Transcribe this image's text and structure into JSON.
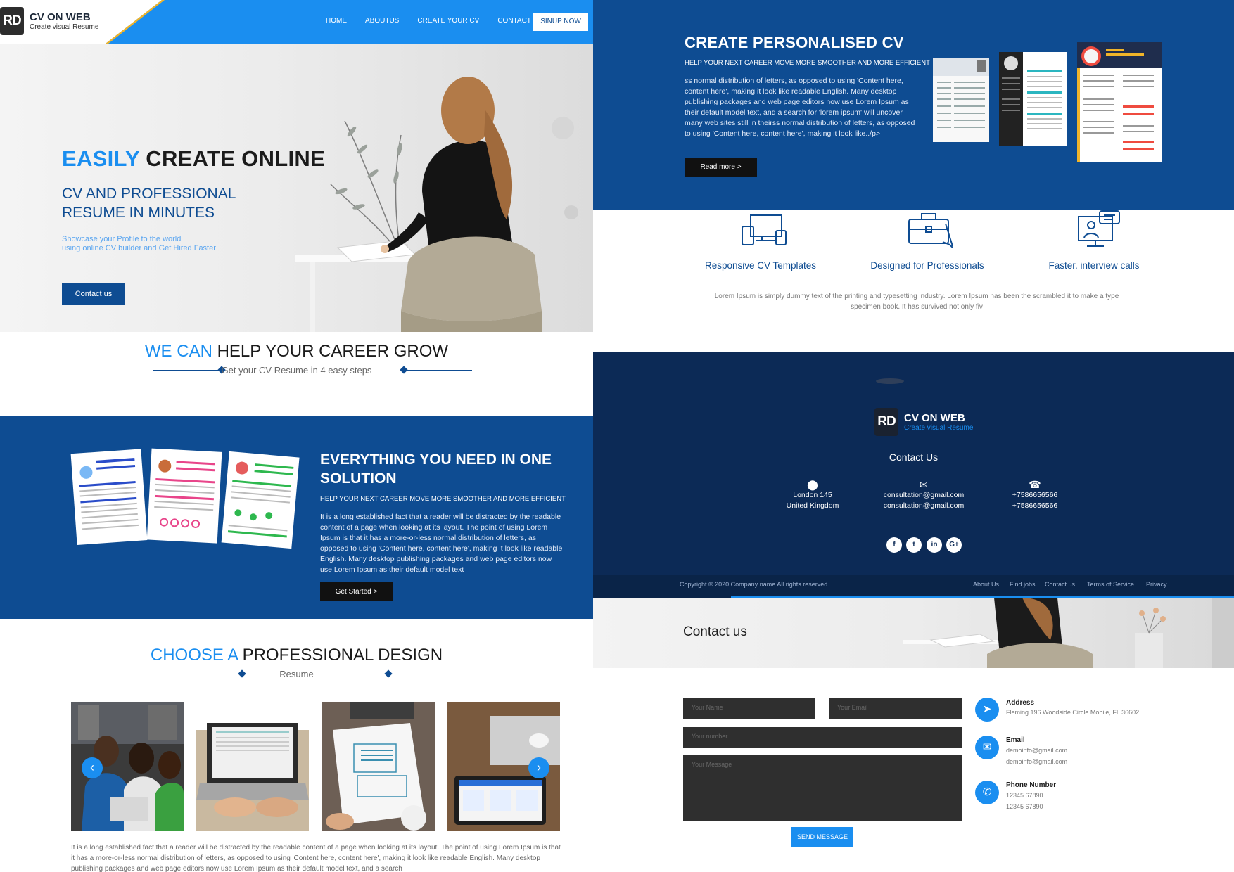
{
  "brand": {
    "mark": "RD",
    "name": "CV ON WEB",
    "tagline": "Create visual Resume"
  },
  "nav": {
    "items": [
      "HOME",
      "ABOUTUS",
      "CREATE YOUR CV",
      "CONTACT US"
    ],
    "cta": "SINUP NOW"
  },
  "hero": {
    "title_accent": "EASILY",
    "title_rest": " CREATE ONLINE",
    "subtitle": "CV AND PROFESSIONAL RESUME IN MINUTES",
    "tagline_1": "Showcase your Profile to the world",
    "tagline_2": "using online CV builder and Get Hired Faster",
    "button": "Contact us"
  },
  "wecan": {
    "title_accent": "WE CAN",
    "title_rest": " HELP YOUR CAREER GROW",
    "subtitle": "Get your CV Resume in 4 easy steps"
  },
  "everything": {
    "title": "EVERYTHING YOU NEED IN ONE SOLUTION",
    "kicker": "HELP YOUR NEXT CAREER MOVE MORE SMOOTHER AND MORE EFFICIENT",
    "body": "It is a long established fact that a reader will be distracted by the readable content of a page when looking at its layout. The point of using Lorem Ipsum is that it has a more-or-less normal distribution of letters, as opposed to using 'Content here, content here', making it look like readable English. Many desktop publishing packages and web page editors now use Lorem Ipsum as their default model text",
    "button": "Get Started >"
  },
  "choose": {
    "title_accent": "CHOOSE A",
    "title_rest": " PROFESSIONAL DESIGN",
    "subtitle": "Resume",
    "body": "It is a long established fact that a reader will be distracted by the readable content of a page when looking at its layout. The point of using Lorem Ipsum is that it has a more-or-less normal distribution of letters, as opposed to using 'Content here, content here', making it look like readable English. Many desktop publishing packages and web page editors now use Lorem Ipsum as their default model text, and a search",
    "prev": "‹",
    "next": "›"
  },
  "create": {
    "title": "CREATE PERSONALISED CV",
    "kicker": "HELP YOUR NEXT CAREER MOVE MORE SMOOTHER AND MORE EFFICIENT",
    "body": "ss normal distribution of letters, as opposed to using 'Content here, content here', making it look like readable English. Many desktop publishing packages and web page editors now use Lorem Ipsum as their default model text, and a search for 'lorem ipsum' will uncover many web sites still in theirss normal distribution of letters, as opposed to using 'Content here, content here', making it look like../p>",
    "button": "Read more >"
  },
  "features": {
    "items": [
      "Responsive CV Templates",
      "Designed for Professionals",
      "Faster. interview calls"
    ],
    "desc": "Lorem Ipsum is simply dummy text of the printing and typesetting industry. Lorem Ipsum has been the scrambled it to make a type specimen book. It has survived not only fiv"
  },
  "footer": {
    "heading": "Contact Us",
    "address": [
      "London 145",
      "United Kingdom"
    ],
    "email": [
      "consultation@gmail.com",
      "consultation@gmail.com"
    ],
    "phone": [
      "+7586656566",
      "+7586656566"
    ],
    "social": [
      "f",
      "t",
      "in",
      "G+"
    ],
    "copyright": "Copyright © 2020.Company name All rights reserved.",
    "links": [
      "About Us",
      "Find jobs",
      "Contact us",
      "Terms of Service",
      "Privacy"
    ]
  },
  "contact": {
    "banner_title": "Contact us",
    "placeholders": {
      "name": "Your Name",
      "email": "Your Email",
      "number": "Your number",
      "message": "Your Message"
    },
    "send": "SEND MESSAGE",
    "address_title": "Address",
    "address_line": "Fleming 196 Woodside Circle Mobile, FL 36602",
    "email_title": "Email",
    "email_lines": [
      "demoinfo@gmail.com",
      "demoinfo@gmail.com"
    ],
    "phone_title": "Phone Number",
    "phone_lines": [
      "12345 67890",
      "12345 67890"
    ]
  },
  "colors": {
    "primary": "#0e4c92",
    "accent": "#1a8ef0",
    "dark": "#0c2a56",
    "gold": "#f0b429"
  }
}
